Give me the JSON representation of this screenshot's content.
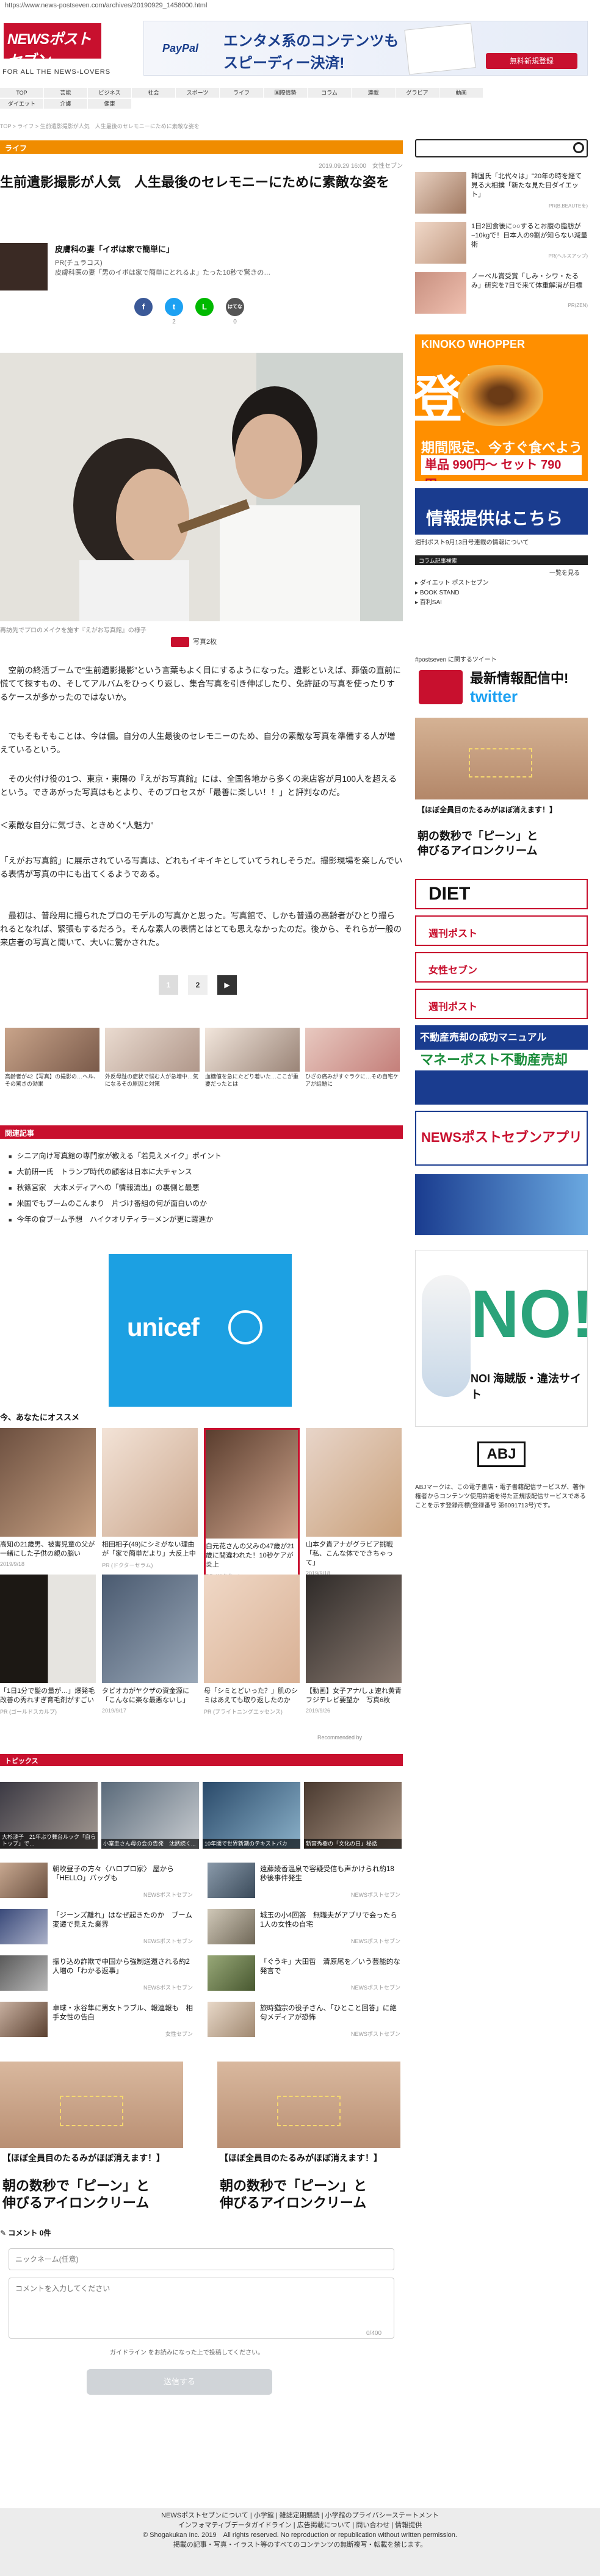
{
  "url": "https://www.news-postseven.com/archives/20190929_1458000.html",
  "site": {
    "logo_main": "NEWSポストセブン",
    "tagline": "FOR ALL THE NEWS-LOVERS"
  },
  "top_ad": {
    "brand": "PayPal",
    "line1": "エンタメ系のコンテンツも",
    "line2": "スピーディー決済!",
    "button": "無料新規登録"
  },
  "nav": {
    "row1": [
      "TOP",
      "芸能",
      "ビジネス",
      "社会",
      "スポーツ",
      "ライフ",
      "国際情勢",
      "コラム",
      "連載",
      "グラビア",
      "動画"
    ],
    "row2": [
      "ダイエット",
      "介護",
      "健康"
    ]
  },
  "breadcrumb": "TOP > ライフ > 生前遺影撮影が人気　人生最後のセレモニーにために素敵な姿を",
  "category": "ライフ",
  "date": "2019.09.29 16:00　女性セブン",
  "article": {
    "title": "生前遺影撮影が人気　人生最後のセレモニーにために素敵な姿を",
    "author_name": "皮膚科の妻「イボは家で簡単に」",
    "author_pr": "PR(チュラコス)",
    "author_desc": "皮膚科医の妻「男のイボは家で簡単にとれるよ」たった10秒で驚きの…",
    "share_counts": [
      "",
      "2",
      "",
      "0"
    ],
    "share_labels": [
      "f",
      "t",
      "L",
      "はてな"
    ],
    "photo_caption": "再訪先でプロのメイクを施す『えがお写真館』の様子",
    "photo_count": "写真2枚",
    "paragraphs": [
      "　空前の終活ブームで“生前遺影撮影”という言葉もよく目にするようになった。遺影といえば、葬儀の直前に慌てて探すもの、そしてアルバムをひっくり返し、集合写真を引き伸ばしたり、免許証の写真を使ったりするケースが多かったのではないか。",
      "　でもそもそもことは、今は個。自分の人生最後のセレモニーのため、自分の素敵な写真を準備する人が増えているという。",
      "　その火付け役の1つ、東京・東陽の『えがお写真館』には、全国各地から多くの来店客が月100人を超えるという。できあがった写真はもとより、そのプロセスが「最善に楽しい！！」と評判なのだ。",
      "＜素敵な自分に気づき、ときめく“人魅力”",
      "「えがお写真館」に展示されている写真は、どれもイキイキとしていてうれしそうだ。撮影現場を楽しんでいる表情が写真の中にも出てくるようである。",
      "　最初は、普段用に撮られたプロのモデルの写真かと思った。写真館で、しかも普通の高齢者がひとり撮られるとなれば、緊張もするだろう。そんな素人の表情とはとても思えなかったのだ。後から、それらが一般の来店者の写真と聞いて、大いに驚かされた。"
    ]
  },
  "pager": {
    "prev": "1",
    "current": "2",
    "next": "▶"
  },
  "related_cards": [
    "高齢者が42【写真】の撮影の…ヘル、その驚きの効果",
    "外反母趾の症状で悩む人が急増中…気になるその原因と対策",
    "血糖値を急にたどり着いた…ここが重要だったとは",
    "ひざの痛みがすぐラクに…その自宅ケアが話題に"
  ],
  "recommended": {
    "header": "関連記事",
    "items": [
      "シニア向け写真館の専門家が教える「若見えメイク」ポイント",
      "大前研一氏　トランプ時代の顧客は日本に大チャンス",
      "秋篠宮家　大本メディアへの「情報流出」の裏側と最悪",
      "米国でもブームのこんまり　片づけ番組の何が面白いのか",
      "今年の食ブーム予想　ハイクオリティラーメンが更に躍進か"
    ]
  },
  "unicef": {
    "text": "unicef"
  },
  "for_you": {
    "header": "今、あなたにオススメ",
    "cards": [
      {
        "text": "高知の21歳男、被害児童の父が一緒にした子供の親の脳い",
        "src": "2019/9/18"
      },
      {
        "text": "相田相子(49)にシミがない理由が「家で簡単だより」大反上中",
        "src": "PR (ドクターセラム)"
      },
      {
        "text": "白元花さんの父みの47歳が21歳に間違われた！10秒ケアが炎上",
        "src": "PR (ドクター)"
      },
      {
        "text": "山本夕貴アナがグラビア挑戦「私、こんな体でできちゃって」",
        "src": "2019/9/18"
      },
      {
        "text": "「1日1分で髪の量が…」爆発毛改善の秀れすぎ育毛剤がすごい",
        "src": "PR (ゴールドスカルプ)"
      },
      {
        "text": "タピオカがヤクザの資金源に「こんなに楽な最悪ないし」",
        "src": "2019/9/17"
      },
      {
        "text": "母「シミとどいった？」肌のシミはあえても取り返したのか",
        "src": "PR (ブライトニングエッセンス)"
      },
      {
        "text": "【動画】女子アナ/しょ速れ黄青　フジテレビ要望か　写真6枚",
        "src": "2019/9/26"
      }
    ],
    "recommended_by": "Recommended by"
  },
  "topics": {
    "header": "トピックス",
    "tiles": [
      "大杉漣子　21年ぶり舞台ルック「自らトップ」で…",
      "小室圭さん母の会の告発　沈黙続く...",
      "10年間で世界新潮のテキストバカ",
      "新宮秀樹の「文化の日」秘話"
    ],
    "items": [
      {
        "text": "朝吹昼子の方々〈ハロプロ家〉 屋から「HELLO」バッグも",
        "src": "NEWSポストセブン"
      },
      {
        "text": "遠藤綾香温泉で容疑受信も声かけられ約18秒後事件発生",
        "src": "NEWSポストセブン"
      },
      {
        "text": "「ジーンズ離れ」はなぜ起きたのか　ブーム変遷で見えた業界",
        "src": "NEWSポストセブン"
      },
      {
        "text": "城玉の小4回答　無職夫がアプリで会ったら1人の女性の自宅",
        "src": "NEWSポストセブン"
      },
      {
        "text": "振り込め詐欺で中国から強制送還される約2人増の「わかる返事」",
        "src": "NEWSポストセブン"
      },
      {
        "text": "「ぐうキ」大田哲　清原尾を／いう芸能的な発言で",
        "src": "NEWSポストセブン"
      },
      {
        "text": "卓球・水谷隼に男女トラブル、報連報も　相手女性の告白",
        "src": "女性セブン"
      },
      {
        "text": "旅時猶宗の役子さん、「ひとこと回答」に絶句メディアが恐怖",
        "src": "NEWSポストセブン"
      }
    ]
  },
  "eye_ad": {
    "head": "【ほぼ全員目のたるみがほぼ消えます！】",
    "big1": "朝の数秒で「ピーン」と",
    "big2": "伸びるアイロンクリーム"
  },
  "comment": {
    "header": "コメント 0件",
    "name_placeholder": "ニックネーム(任意)",
    "body_placeholder": "コメントを入力してください",
    "counter": "0/400",
    "note": "ガイドライン をお読みになった上で投稿してください。",
    "submit": "送信する"
  },
  "sidebar": {
    "ranking": [
      {
        "text": "韓国氏「北代々は」\"20年の時を経て見る大相撲「新たな見た目ダイエット」",
        "src": "PR(B.BEAUTEを)"
      },
      {
        "text": "1日2回食後に○○するとお腹の脂肪が−10kgで！日本人の9割が知らない減量術",
        "src": "PR(ヘルスアップ)"
      },
      {
        "text": "ノーベル賞受賞「しみ・シワ・たるみ」研究を7日で来て体重解消が目標",
        "src": "PR(ZEN)"
      }
    ],
    "bk_ad": {
      "title": "KINOKO WHOPPER",
      "big": "登場",
      "period": "期間限定、今すぐ食べよう",
      "price": "単品 990円〜 セット 790円〜"
    },
    "info_banner": "情報提供はこちら",
    "info_note": "週刊ポスト9月13日号連載の情報について",
    "column_bar": "コラム記事検索",
    "column_more": "一覧を見る",
    "column_links": [
      "ダイエット ポストセブン",
      "BOOK STAND",
      "百利SAI"
    ],
    "twitter_handle": "#postseven に関するツイート",
    "twitter_t1": "最新情報配信中!",
    "twitter_t2": "twitter",
    "banners": [
      "DIET",
      "週刊ポスト",
      "女性セブン",
      "不動産売却の成功マニュアル",
      "マネーポスト不動産売却",
      "NEWSポストセブンアプリ",
      "NOI 海賊版・違法サイト"
    ],
    "adj": "ABJ",
    "adj_desc": "ABJマークは、この電子書店・電子書籍配信サービスが、著作権者からコンテンツ使用許諾を得た正規版配信サービスであることを示す登録商標(登録番号 第6091713号)です。"
  },
  "footer": {
    "line1": "NEWSポストセブンについて | 小学館 | 雑誌定期購読 | 小学館のプライバシーステートメント",
    "line2": "インフォマティブデータガイドライン | 広告掲載について | 問い合わせ | 情報提供",
    "line3": "© Shogakukan Inc. 2019　All rights reserved. No reproduction or republication without written permission.",
    "line4": "掲載の記事・写真・イラスト等のすべてのコンテンツの無断複写・転載を禁じます。"
  },
  "colors": {
    "brand": "#c8102e",
    "category": "#f08c00",
    "twitter": "#1da1f2"
  }
}
